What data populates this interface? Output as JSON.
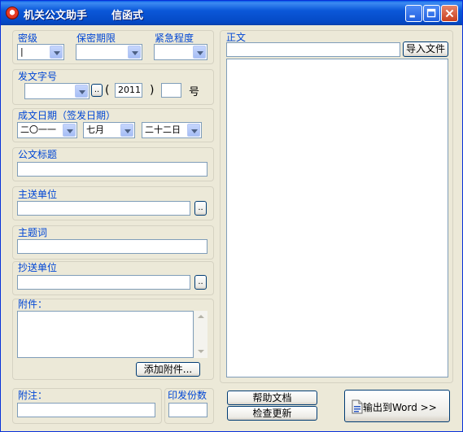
{
  "window": {
    "title": "机关公文助手",
    "subtitle": "信函式"
  },
  "top_fields": {
    "secret_label": "密级",
    "secret_value": "|",
    "period_label": "保密期限",
    "period_value": "",
    "urgency_label": "紧急程度",
    "urgency_value": ""
  },
  "doc_number": {
    "label": "发文字号",
    "prefix_value": "",
    "browse_label": "..",
    "open_paren": "(",
    "year_value": "2011",
    "close_paren": ")",
    "number_value": "",
    "suffix": "号"
  },
  "date": {
    "label": "成文日期（签发日期）",
    "year": "二〇一一",
    "month": "七月",
    "day": "二十二日"
  },
  "title_field": {
    "label": "公文标题",
    "value": ""
  },
  "recipient": {
    "label": "主送单位",
    "value": "",
    "browse_label": ".."
  },
  "keywords": {
    "label": "主题词",
    "value": ""
  },
  "cc": {
    "label": "抄送单位",
    "value": "",
    "browse_label": ".."
  },
  "attachments": {
    "label": "附件：",
    "add_button": "添加附件..."
  },
  "notes": {
    "label": "附注：",
    "value": ""
  },
  "copies": {
    "label": "印发份数",
    "value": ""
  },
  "body": {
    "label": "正文",
    "file_path": "",
    "import_button": "导入文件"
  },
  "buttons": {
    "help": "帮助文档",
    "update": "检查更新",
    "export": "输出到Word >>"
  },
  "colors": {
    "titlebar": "#0b58d9",
    "label_blue": "#0046d5",
    "background": "#ece9d8"
  }
}
